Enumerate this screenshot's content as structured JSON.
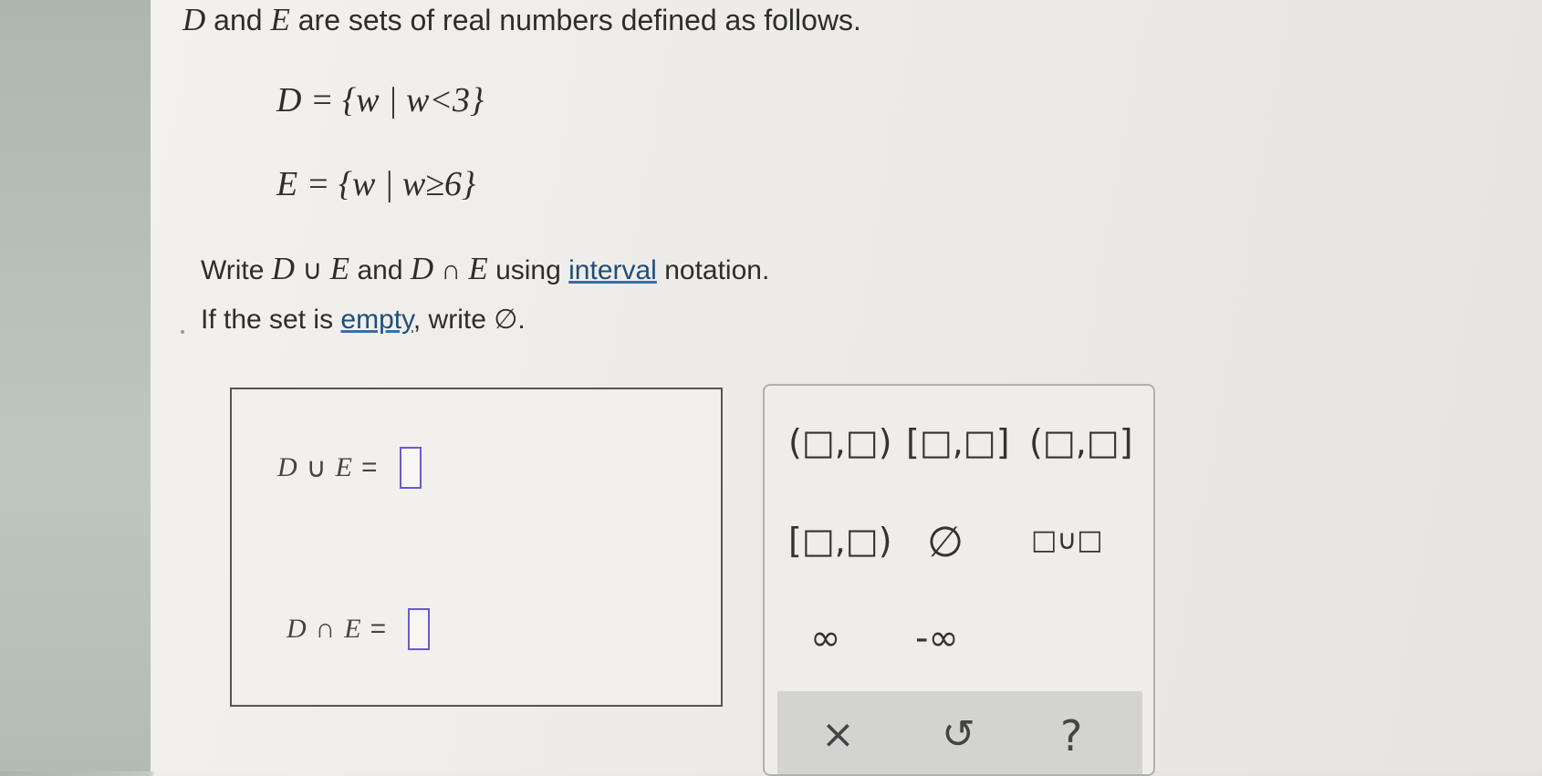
{
  "problem": {
    "intro_d": "D",
    "intro_and": " and ",
    "intro_e": "E",
    "intro_rest": " are sets of real numbers defined as follows.",
    "set_d": "D = {w | w<3}",
    "set_e": "E = {w | w≥6}",
    "instr1_pre": "Write ",
    "instr1_d1": "D",
    "instr1_union": " ∪ ",
    "instr1_e1": "E",
    "instr1_and": " and ",
    "instr1_d2": "D",
    "instr1_inter": " ∩ ",
    "instr1_e2": "E",
    "instr1_using": " using ",
    "instr1_link": "interval",
    "instr1_post": " notation.",
    "instr2_pre": "If the set is ",
    "instr2_link": "empty",
    "instr2_post": ", write ∅."
  },
  "answers": {
    "union_lhs": "D",
    "union_sym": "∪",
    "union_rhs": "E",
    "union_eq": "=",
    "union_value": "",
    "inter_lhs": "D",
    "inter_sym": "∩",
    "inter_rhs": "E",
    "inter_eq": "=",
    "inter_value": ""
  },
  "palette": {
    "open_open": "(□,□)",
    "closed_closed": "[□,□]",
    "open_closed": "(□,□]",
    "closed_open": "[□,□)",
    "empty_set": "∅",
    "union": "□∪□",
    "infinity": "∞",
    "neg_infinity": "-∞",
    "clear": "×",
    "undo": "↺",
    "help": "?"
  }
}
